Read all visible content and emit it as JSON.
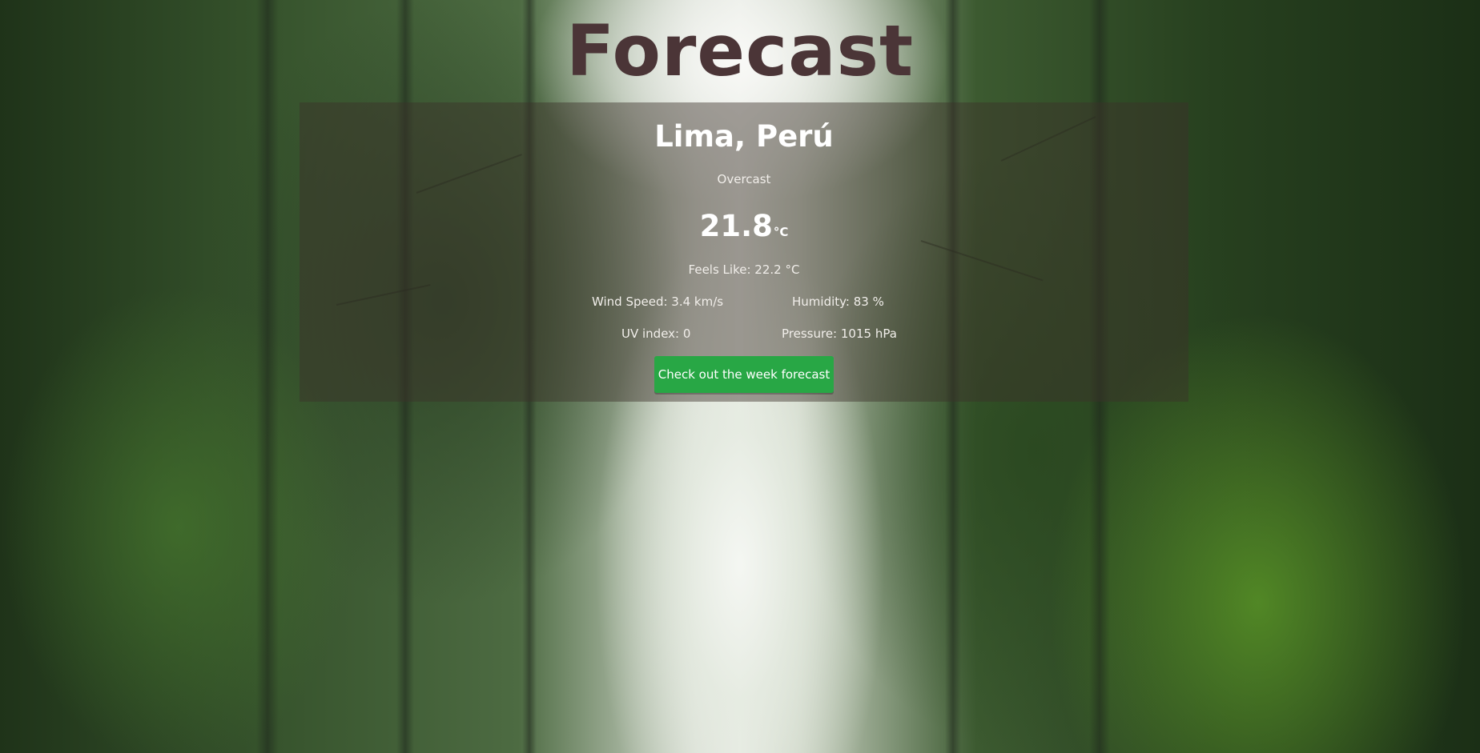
{
  "page": {
    "title": "Forecast"
  },
  "weather": {
    "location": "Lima, Perú",
    "condition": "Overcast",
    "temperature": "21.8",
    "temperature_unit": "°C",
    "feels_like": "Feels Like: 22.2 °C",
    "wind_speed": "Wind Speed: 3.4 km/s",
    "humidity": "Humidity: 83 %",
    "uv_index": "UV index: 0",
    "pressure": "Pressure: 1015 hPa"
  },
  "actions": {
    "week_forecast_label": "Check out the week forecast"
  },
  "colors": {
    "title": "#4b3537",
    "card_overlay": "rgba(60,48,42,0.45)",
    "button": "#28a745",
    "text": "#ffffff"
  }
}
